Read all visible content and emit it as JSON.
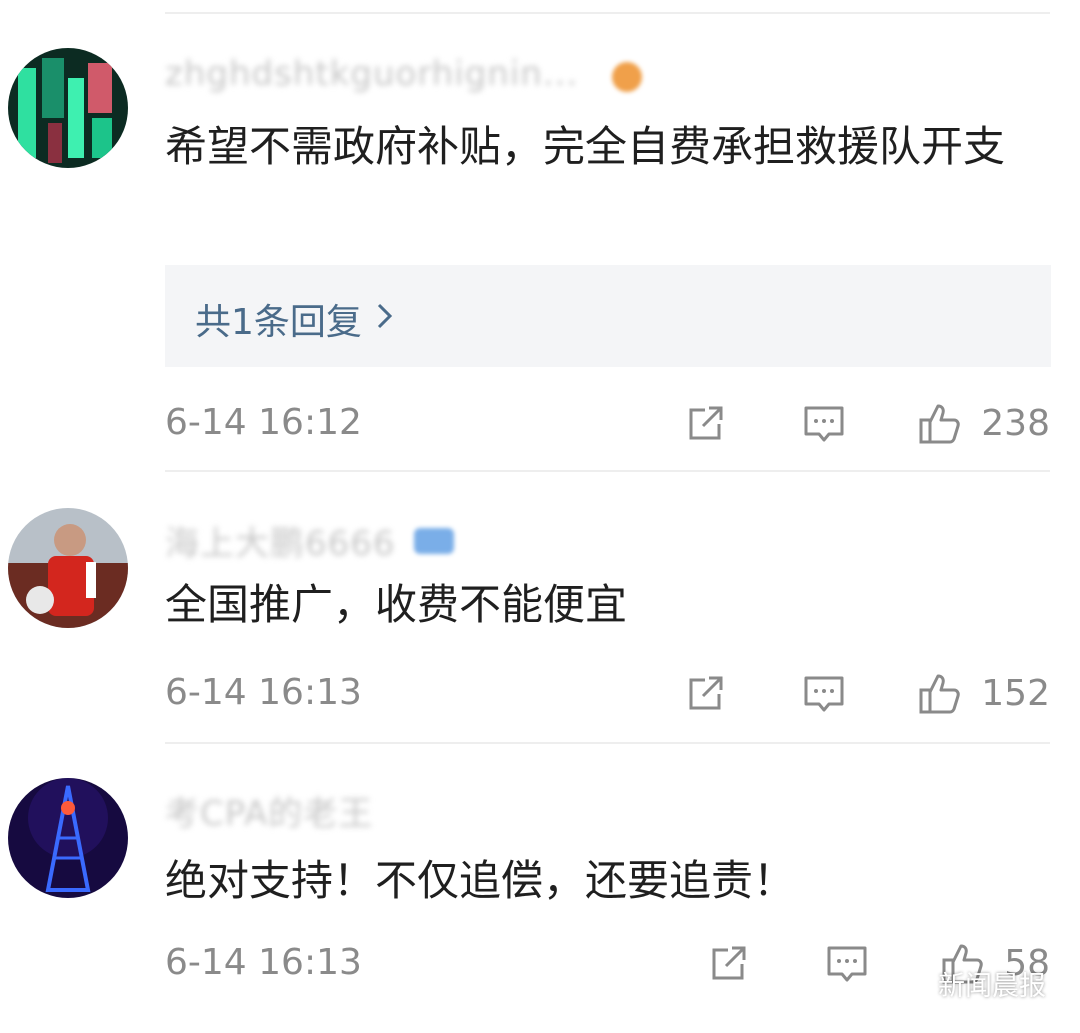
{
  "colors": {
    "text": "#1f1f1f",
    "meta": "#8a8a8a",
    "reply_link": "#4a6b8a",
    "reply_bg": "#f4f5f7",
    "divider": "#eeeeee"
  },
  "comments": [
    {
      "username": "zhghdshtkguorhignin...",
      "badge": "orange-vip-badge",
      "text": "希望不需政府补贴，完全自费承担救援队开支",
      "reply": {
        "label": "共1条回复",
        "icon": "chevron-right-icon"
      },
      "time": "6-14 16:12",
      "likes": "238",
      "avatar": "green-blurred-avatar"
    },
    {
      "username": "海上大鹏6666",
      "badge": "blue-member-badge",
      "text": "全国推广，收费不能便宜",
      "time": "6-14 16:13",
      "likes": "152",
      "avatar": "football-player-avatar"
    },
    {
      "username": "考CPA的老王",
      "badge": "",
      "text": "绝对支持！不仅追偿，还要追责！",
      "time": "6-14 16:13",
      "likes": "58",
      "avatar": "tower-night-avatar"
    }
  ],
  "icons": {
    "share": "share-icon",
    "comment": "comment-icon",
    "like": "thumbs-up-icon"
  },
  "watermark": {
    "icon": "wechat-icon",
    "label": "新闻晨报"
  }
}
